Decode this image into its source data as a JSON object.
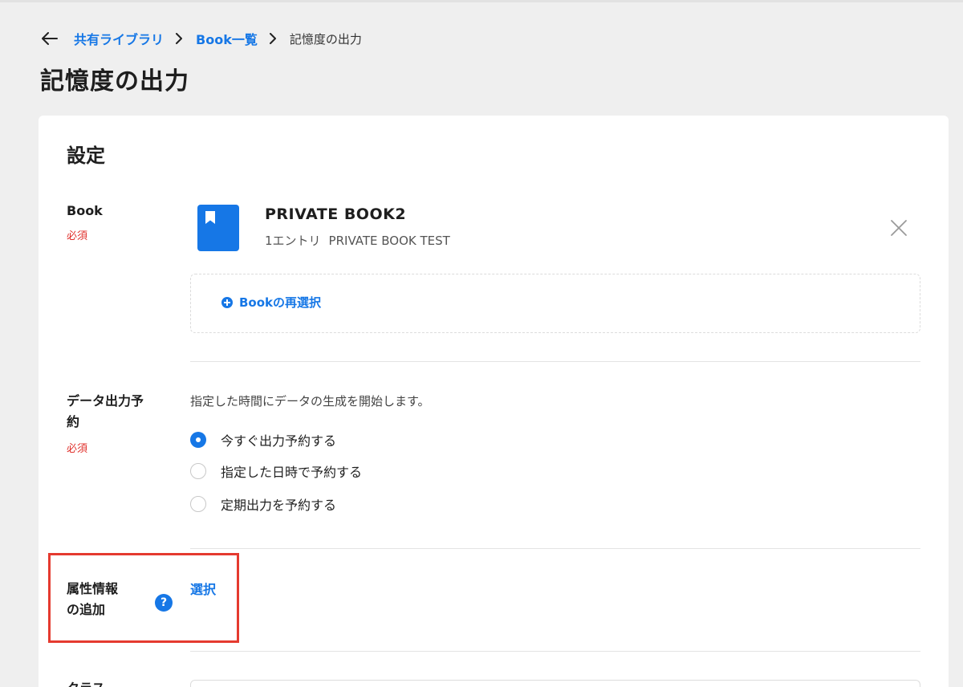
{
  "breadcrumb": {
    "items": [
      "共有ライブラリ",
      "Book一覧"
    ],
    "current": "記憶度の出力"
  },
  "page": {
    "title": "記憶度の出力"
  },
  "card": {
    "title": "設定",
    "book": {
      "label": "Book",
      "required": "必須",
      "name": "PRIVATE BOOK2",
      "entries": "1エントリ",
      "description": "PRIVATE BOOK TEST",
      "reselect_label": "Bookの再選択"
    },
    "schedule": {
      "label_line1": "データ出力予",
      "label_line2": "約",
      "required": "必須",
      "description": "指定した時間にデータの生成を開始します。",
      "options": [
        {
          "label": "今すぐ出力予約する",
          "selected": true
        },
        {
          "label": "指定した日時で予約する",
          "selected": false
        },
        {
          "label": "定期出力を予約する",
          "selected": false
        }
      ]
    },
    "attributes": {
      "label_line1": "属性情報",
      "label_line2": "の追加",
      "help": "?",
      "select_label": "選択"
    },
    "next_section": {
      "label": "クラス"
    }
  },
  "colors": {
    "accent": "#1677e6",
    "required": "#e0302b",
    "highlight": "#e53a2f",
    "background": "#efefef"
  },
  "icons": [
    "back-arrow-icon",
    "chevron-right-icon",
    "book-icon",
    "close-icon",
    "plus-circle-icon",
    "help-icon"
  ]
}
